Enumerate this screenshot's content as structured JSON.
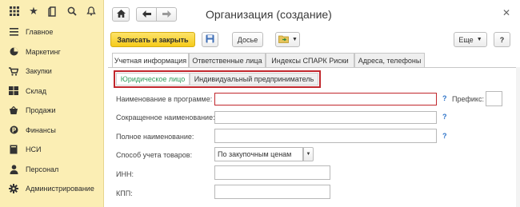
{
  "sidebar": {
    "top_icons": [
      "grid-icon",
      "star-icon",
      "history-icon",
      "search-icon",
      "bell-icon"
    ],
    "items": [
      {
        "label": "Главное",
        "icon": "menu-icon"
      },
      {
        "label": "Маркетинг",
        "icon": "pie-icon"
      },
      {
        "label": "Закупки",
        "icon": "cart-icon"
      },
      {
        "label": "Склад",
        "icon": "warehouse-icon"
      },
      {
        "label": "Продажи",
        "icon": "basket-icon"
      },
      {
        "label": "Финансы",
        "icon": "coin-icon"
      },
      {
        "label": "НСИ",
        "icon": "book-icon"
      },
      {
        "label": "Персонал",
        "icon": "person-icon"
      },
      {
        "label": "Администрирование",
        "icon": "gear-icon"
      }
    ]
  },
  "window": {
    "title": "Организация (создание)"
  },
  "toolbar": {
    "save_close": "Записать и закрыть",
    "dossier": "Досье",
    "more": "Еще",
    "help": "?"
  },
  "tabs": [
    {
      "label": "Учетная информация"
    },
    {
      "label": "Ответственные лица"
    },
    {
      "label": "Индексы СПАРК Риски"
    },
    {
      "label": "Адреса, телефоны"
    }
  ],
  "subtabs": [
    {
      "label": "Юридическое лицо"
    },
    {
      "label": "Индивидуальный предприниматель"
    }
  ],
  "form": {
    "name_program": {
      "label": "Наименование в программе:",
      "value": ""
    },
    "prefix": {
      "label": "Префикс:",
      "value": ""
    },
    "short_name": {
      "label": "Сокращенное наименование:",
      "value": ""
    },
    "full_name": {
      "label": "Полное наименование:",
      "value": ""
    },
    "accounting": {
      "label": "Способ учета товаров:",
      "value": "По закупочным ценам"
    },
    "inn": {
      "label": "ИНН:",
      "value": ""
    },
    "kpp": {
      "label": "КПП:",
      "value": ""
    },
    "hint": "?"
  },
  "colors": {
    "sidebar_bg": "#fbeeb4",
    "accent_yellow": "#f6cb1b",
    "highlight_red": "#c1272d",
    "active_subtab": "#2e9a5a",
    "hint_blue": "#2b72c9"
  }
}
